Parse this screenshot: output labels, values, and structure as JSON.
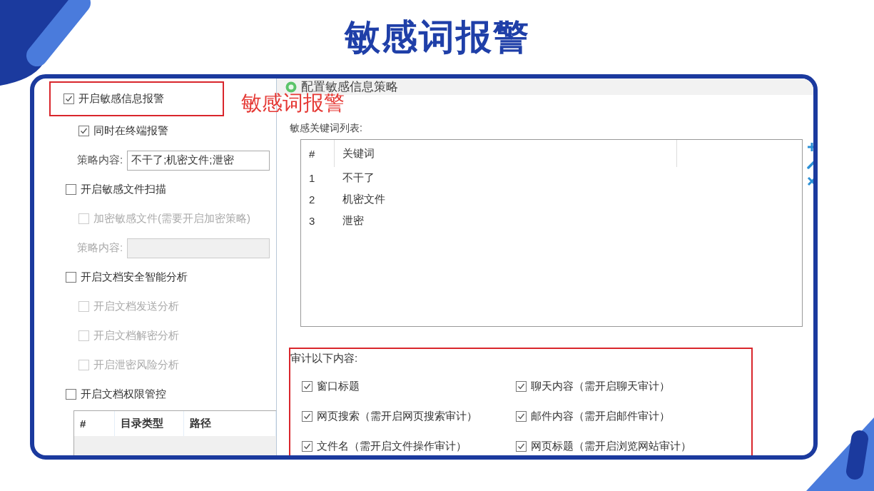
{
  "title": "敏感词报警",
  "annotation": "敏感词报警",
  "left_panel": {
    "options": [
      {
        "kind": "checkbox",
        "label": "开启敏感信息报警",
        "checked": true,
        "disabled": false,
        "highlighted": true,
        "children": [
          {
            "kind": "checkbox",
            "label": "同时在终端报警",
            "checked": true,
            "disabled": false
          },
          {
            "kind": "field",
            "label": "策略内容:",
            "value": "不干了;机密文件;泄密",
            "disabled": false
          }
        ]
      },
      {
        "kind": "checkbox",
        "label": "开启敏感文件扫描",
        "checked": false,
        "disabled": false,
        "highlighted": false,
        "children": [
          {
            "kind": "checkbox",
            "label": "加密敏感文件(需要开启加密策略)",
            "checked": false,
            "disabled": true
          },
          {
            "kind": "field",
            "label": "策略内容:",
            "disabled": true
          }
        ]
      },
      {
        "kind": "checkbox",
        "label": "开启文档安全智能分析",
        "checked": false,
        "disabled": false,
        "highlighted": false,
        "children": [
          {
            "kind": "checkbox",
            "label": "开启文档发送分析",
            "checked": false,
            "disabled": true
          },
          {
            "kind": "checkbox",
            "label": "开启文档解密分析",
            "checked": false,
            "disabled": true
          },
          {
            "kind": "checkbox",
            "label": "开启泄密风险分析",
            "checked": false,
            "disabled": true
          }
        ]
      },
      {
        "kind": "checkbox",
        "label": "开启文档权限管控",
        "checked": false,
        "disabled": false,
        "highlighted": false,
        "children": [
          {
            "kind": "table",
            "columns": [
              "#",
              "目录类型",
              "路径"
            ]
          }
        ]
      }
    ]
  },
  "dialog": {
    "title": "配置敏感信息策略",
    "keyword_label": "敏感关键词列表:",
    "keyword_table": {
      "columns": [
        "#",
        "关键词"
      ],
      "rows": [
        [
          "1",
          "不干了"
        ],
        [
          "2",
          "机密文件"
        ],
        [
          "3",
          "泄密"
        ]
      ]
    },
    "audit": {
      "label": "审计以下内容:",
      "items": [
        {
          "label": "窗口标题",
          "checked": true
        },
        {
          "label": "聊天内容（需开启聊天审计）",
          "checked": true
        },
        {
          "label": "网页搜索（需开启网页搜索审计）",
          "checked": true
        },
        {
          "label": "邮件内容（需开启邮件审计）",
          "checked": true
        },
        {
          "label": "文件名（需开启文件操作审计）",
          "checked": true
        },
        {
          "label": "网页标题（需开启浏览网站审计）",
          "checked": true
        }
      ]
    }
  }
}
